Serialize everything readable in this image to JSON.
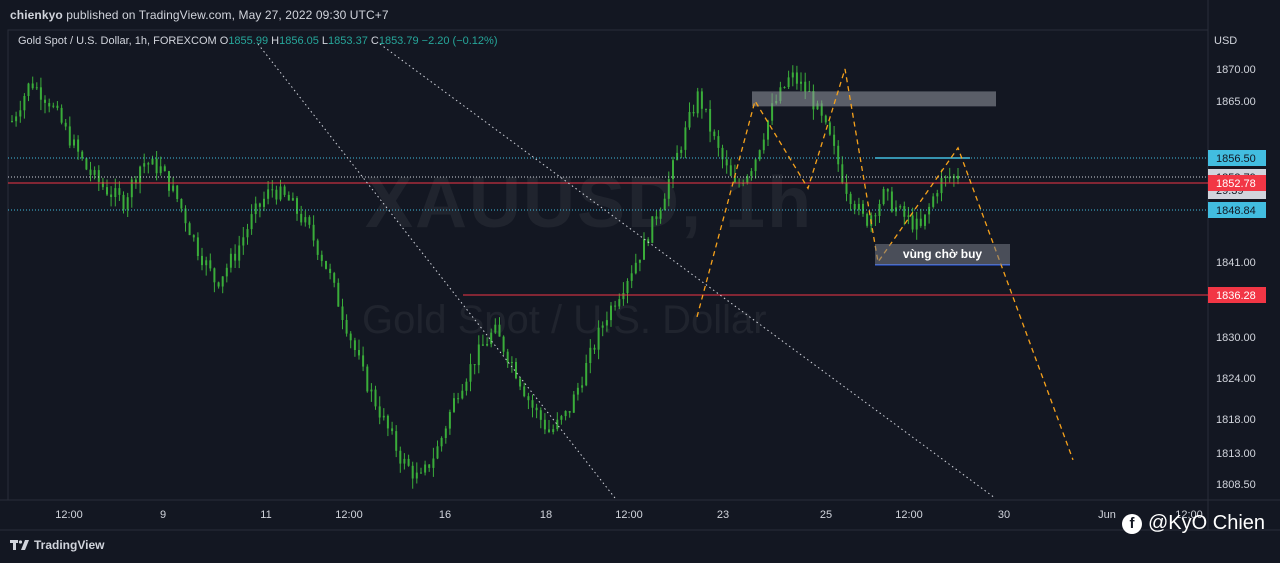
{
  "header": {
    "publisher_user": "chienkyo",
    "publisher_text": "published on TradingView.com, May 27, 2022 09:30 UTC+7"
  },
  "legend": {
    "symbol_desc": "Gold Spot / U.S. Dollar, 1h, FOREXCOM",
    "o_label": "O",
    "o_value": "1855.99",
    "h_label": "H",
    "h_value": "1856.05",
    "l_label": "L",
    "l_value": "1853.37",
    "c_label": "C",
    "c_value": "1853.79",
    "change": "−2.20 (−0.12%)"
  },
  "watermark": {
    "symbol": "XAUUSD, 1h",
    "description": "Gold Spot / U.S. Dollar"
  },
  "annotation": {
    "zone_label": "vùng chờ buy"
  },
  "footer": {
    "brand": "TradingView",
    "author": "@KyO Chien"
  },
  "colors": {
    "background": "#131722",
    "candle_up": "#26a69a",
    "candle_body": "#3aad3a",
    "red_line": "#f23645",
    "cyan_line": "#22ab94",
    "orange_path": "#f7a21b"
  },
  "chart_data": {
    "type": "candlestick",
    "symbol": "XAUUSD",
    "interval": "1h",
    "currency": "USD",
    "ylim": [
      1806,
      1875
    ],
    "price_ticks": [
      1870.0,
      1865.0,
      1841.0,
      1830.0,
      1824.0,
      1818.0,
      1813.0,
      1808.5
    ],
    "x_ticks": [
      "12:00",
      "9",
      "11",
      "12:00",
      "16",
      "18",
      "12:00",
      "23",
      "25",
      "12:00",
      "30",
      "Jun",
      "12:00"
    ],
    "price_labels": [
      {
        "value": "1856.50",
        "kind": "level"
      },
      {
        "value": "1853.79",
        "kind": "last",
        "countdown": "29:39"
      },
      {
        "value": "1852.78",
        "kind": "level"
      },
      {
        "value": "1848.84",
        "kind": "level"
      },
      {
        "value": "1836.28",
        "kind": "level"
      }
    ],
    "series": [
      {
        "values": [
          1862,
          1868,
          1865,
          1860,
          1855,
          1852,
          1850,
          1856,
          1855,
          1850,
          1843,
          1838,
          1842,
          1848,
          1852,
          1850,
          1846,
          1840,
          1832,
          1824,
          1818,
          1812,
          1809,
          1814,
          1822,
          1827,
          1831,
          1826,
          1820,
          1816,
          1819,
          1826,
          1833,
          1838,
          1843,
          1850,
          1858,
          1866,
          1858,
          1852,
          1856,
          1864,
          1869,
          1866,
          1860,
          1852,
          1847,
          1851,
          1848,
          1846,
          1853,
          1854
        ]
      }
    ],
    "levels": [
      {
        "price": 1856.5,
        "style": "dotted",
        "color": "cyan"
      },
      {
        "price": 1853.79,
        "style": "dotted",
        "color": "white"
      },
      {
        "price": 1852.78,
        "style": "solid",
        "color": "red"
      },
      {
        "price": 1848.84,
        "style": "dotted",
        "color": "cyan"
      },
      {
        "price": 1836.28,
        "style": "solid",
        "color": "red"
      }
    ],
    "drawings": {
      "resistance_box": {
        "from": 1866.5,
        "to": 1864.2
      },
      "buy_zone": {
        "from": 1843.0,
        "to": 1840.8
      },
      "orange_projection": [
        1833,
        1865,
        1852,
        1870,
        1841,
        1858,
        1812
      ],
      "trendlines": 2
    }
  }
}
